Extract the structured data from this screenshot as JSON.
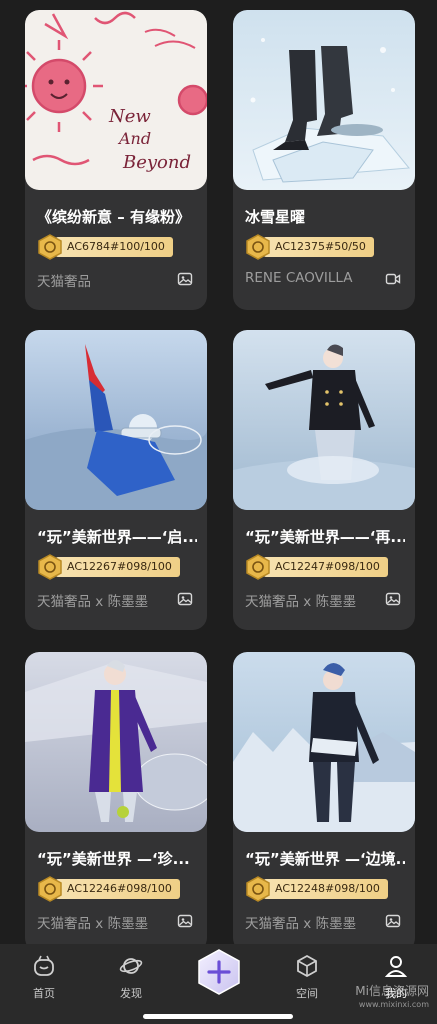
{
  "cards": [
    {
      "title": "《缤纷新意 – 有缘粉》",
      "code": "AC6784#100/100",
      "brand": "天猫奢品",
      "media": "image-icon",
      "art": "pink-sketch"
    },
    {
      "title": "冰雪星曜",
      "code": "AC12375#50/50",
      "brand": "RENE CAOVILLA",
      "media": "video-icon",
      "art": "ice-boots"
    },
    {
      "title": "“玩”美新世界——‘启...",
      "code": "AC12267#098/100",
      "brand": "天猫奢品 x 陈墨墨",
      "media": "image-icon",
      "art": "blue-suit"
    },
    {
      "title": "“玩”美新世界——‘再...",
      "code": "AC12247#098/100",
      "brand": "天猫奢品 x 陈墨墨",
      "media": "image-icon",
      "art": "black-blazer"
    },
    {
      "title": "“玩”美新世界 —‘珍...",
      "code": "AC12246#098/100",
      "brand": "天猫奢品 x 陈墨墨",
      "media": "image-icon",
      "art": "purple-coat"
    },
    {
      "title": "“玩”美新世界 —‘边境...",
      "code": "AC12248#098/100",
      "brand": "天猫奢品 x 陈墨墨",
      "media": "image-icon",
      "art": "navy-jacket"
    }
  ],
  "art_text": {
    "sketch_line1": "New",
    "sketch_line2": "And",
    "sketch_line3": "Beyond"
  },
  "tabbar": {
    "home": "首页",
    "discover": "发现",
    "space": "空间",
    "mine": "我的"
  },
  "watermark": {
    "line1": "Mi信息资源网",
    "line2": "www.mixinxi.com"
  },
  "colors": {
    "background": "#1e1e1e",
    "card": "#333334",
    "badge": "#efcf86",
    "muted_text": "#9d9d9d"
  }
}
